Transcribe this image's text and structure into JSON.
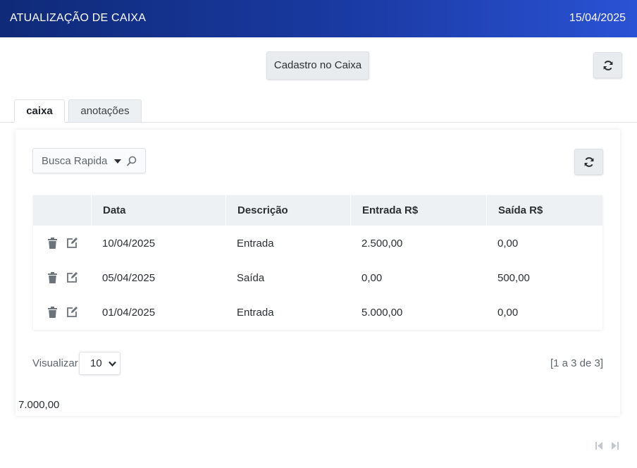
{
  "header": {
    "title": "ATUALIZAÇÃO DE CAIXA",
    "date": "15/04/2025"
  },
  "toolbar": {
    "register_label": "Cadastro no Caixa",
    "refresh_icon": "refresh-icon"
  },
  "tabs": [
    {
      "label": "caixa",
      "active": true
    },
    {
      "label": "anotações",
      "active": false
    }
  ],
  "search": {
    "placeholder": "Busca Rapida",
    "icon": "search-icon"
  },
  "table": {
    "columns": [
      "",
      "Data",
      "Descrição",
      "Entrada R$",
      "Saída R$"
    ],
    "rows": [
      {
        "data": "10/04/2025",
        "descricao": "Entrada",
        "entrada": "2.500,00",
        "saida": "0,00"
      },
      {
        "data": "05/04/2025",
        "descricao": "Saída",
        "entrada": "0,00",
        "saida": "500,00"
      },
      {
        "data": "01/04/2025",
        "descricao": "Entrada",
        "entrada": "5.000,00",
        "saida": "0,00"
      }
    ],
    "row_actions": [
      "trash-icon",
      "edit-icon"
    ]
  },
  "footer": {
    "view_label": "Visualizar",
    "page_size": "10",
    "page_info": "[1 a 3 de 3]",
    "total": "7.000,00"
  },
  "colors": {
    "header_start": "#0f2a78",
    "header_end": "#2a52d4",
    "button_bg": "#e9ecef",
    "table_header_bg": "#eef1f4"
  }
}
